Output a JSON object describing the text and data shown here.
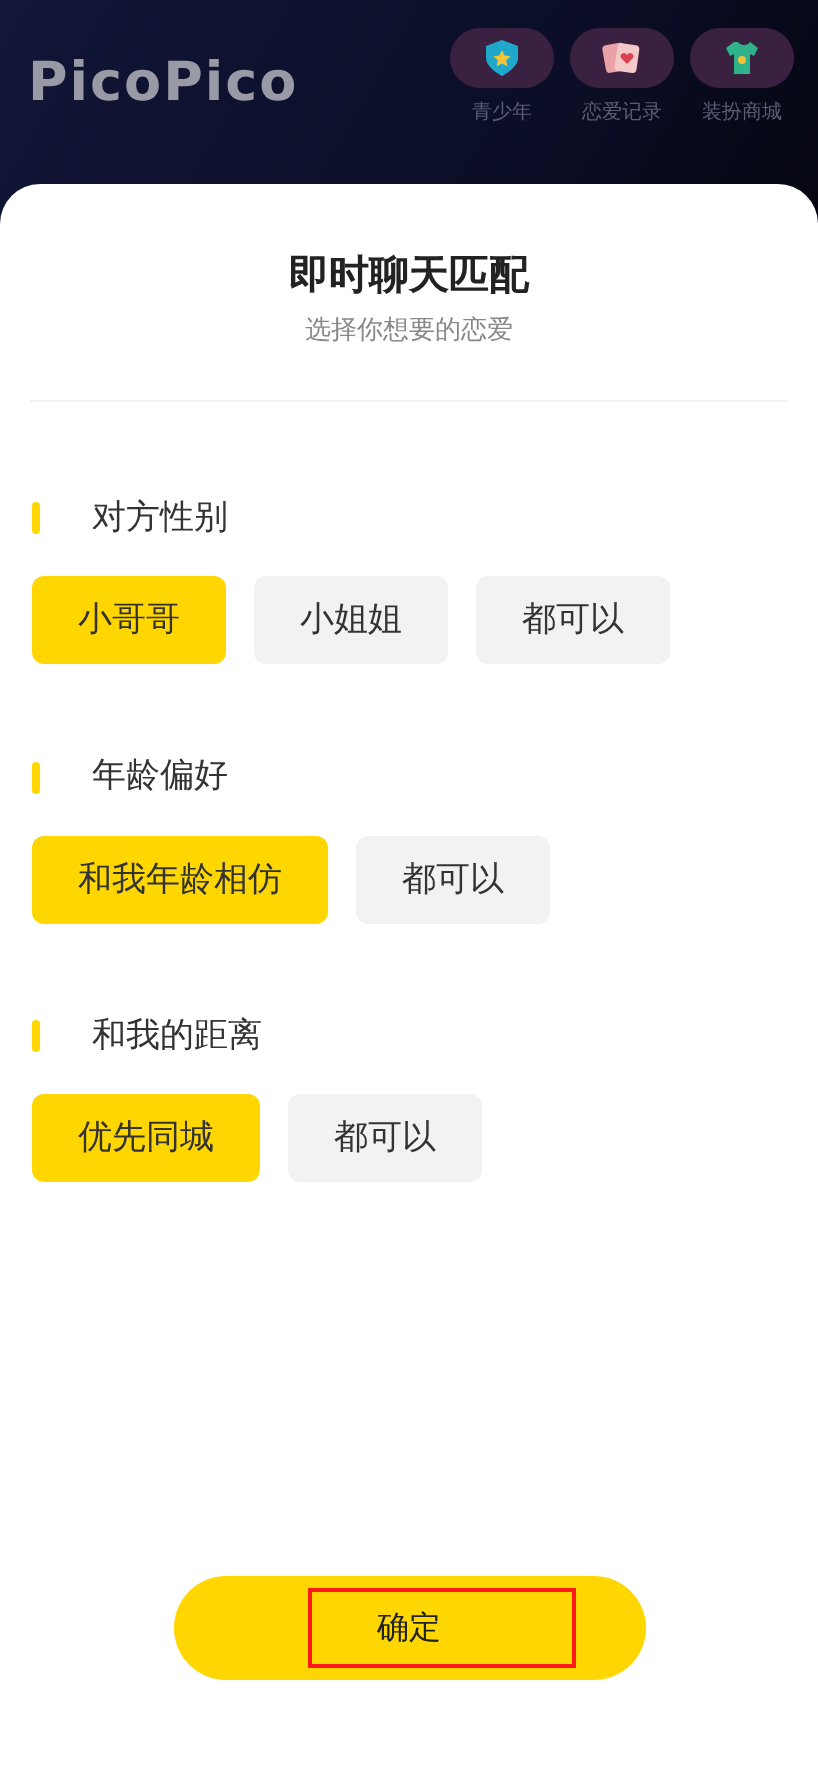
{
  "header": {
    "logo": "PicoPico",
    "shortcuts": [
      {
        "label": "青少年",
        "kind": "shield"
      },
      {
        "label": "恋爱记录",
        "kind": "cards"
      },
      {
        "label": "装扮商城",
        "kind": "shirt"
      }
    ]
  },
  "sheet": {
    "title": "即时聊天匹配",
    "subtitle": "选择你想要的恋爱",
    "sections": [
      {
        "heading": "对方性别",
        "options": [
          {
            "label": "小哥哥",
            "selected": true
          },
          {
            "label": "小姐姐",
            "selected": false
          },
          {
            "label": "都可以",
            "selected": false
          }
        ]
      },
      {
        "heading": "年龄偏好",
        "options": [
          {
            "label": "和我年龄相仿",
            "selected": true
          },
          {
            "label": "都可以",
            "selected": false
          }
        ]
      },
      {
        "heading": "和我的距离",
        "options": [
          {
            "label": "优先同城",
            "selected": true
          },
          {
            "label": "都可以",
            "selected": false
          }
        ]
      }
    ],
    "confirm": {
      "label": "确定",
      "highlighted": true
    }
  }
}
